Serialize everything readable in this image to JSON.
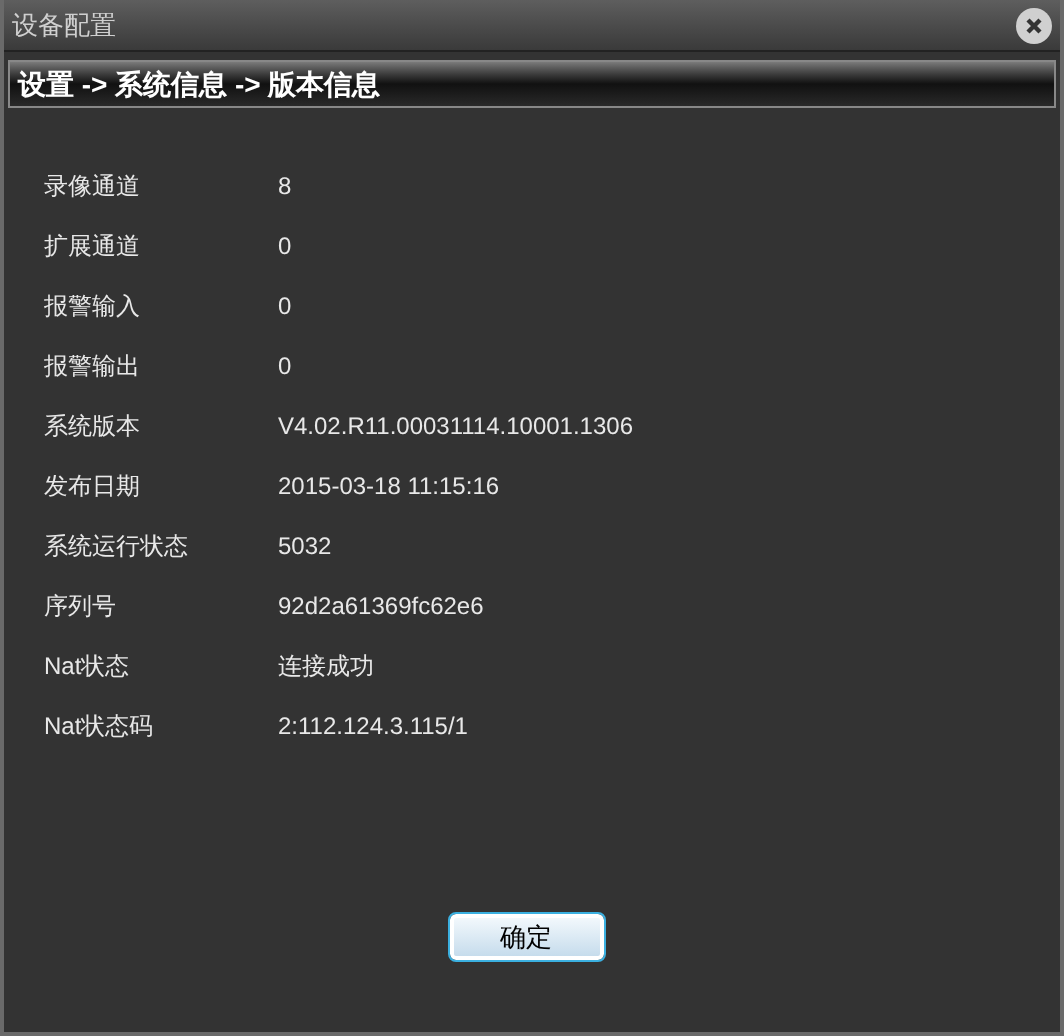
{
  "window": {
    "title": "设备配置"
  },
  "breadcrumb": "设置 -> 系统信息 -> 版本信息",
  "rows": [
    {
      "label": "录像通道",
      "value": "8"
    },
    {
      "label": "扩展通道",
      "value": "0"
    },
    {
      "label": "报警输入",
      "value": "0"
    },
    {
      "label": "报警输出",
      "value": "0"
    },
    {
      "label": "系统版本",
      "value": "V4.02.R11.00031114.10001.1306"
    },
    {
      "label": "发布日期",
      "value": "2015-03-18 11:15:16"
    },
    {
      "label": "系统运行状态",
      "value": "5032"
    },
    {
      "label": "序列号",
      "value": "92d2a61369fc62e6"
    },
    {
      "label": "Nat状态",
      "value": "连接成功"
    },
    {
      "label": "Nat状态码",
      "value": "2:112.124.3.115/1"
    }
  ],
  "buttons": [
    "确定"
  ]
}
